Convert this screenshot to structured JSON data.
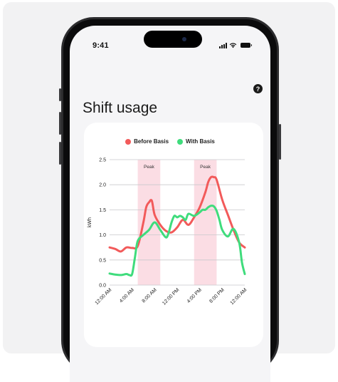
{
  "status_bar": {
    "time": "9:41"
  },
  "header": {
    "help_label": "?",
    "title": "Shift usage"
  },
  "colors": {
    "before": "#f25a5a",
    "with": "#3fdc7c",
    "peak_band": "#fbdde4"
  },
  "chart_data": {
    "type": "line",
    "ylabel": "kWh",
    "ylim": [
      0,
      2.5
    ],
    "yticks": [
      "0.0",
      "0.5",
      "1.0",
      "1.5",
      "2.0",
      "2.5"
    ],
    "xlim": [
      0,
      24
    ],
    "xticks": [
      {
        "hour": 0,
        "label": "12:00 AM"
      },
      {
        "hour": 4,
        "label": "4:00 AM"
      },
      {
        "hour": 8,
        "label": "8:00 AM"
      },
      {
        "hour": 12,
        "label": "12:00 PM"
      },
      {
        "hour": 16,
        "label": "4:00 PM"
      },
      {
        "hour": 20,
        "label": "8:00 PM"
      },
      {
        "hour": 24,
        "label": "12:00 AM"
      }
    ],
    "peaks": [
      {
        "label": "Peak",
        "start": 5,
        "end": 9
      },
      {
        "label": "Peak",
        "start": 15,
        "end": 19
      }
    ],
    "legend": [
      "Before Basis",
      "With Basis"
    ],
    "series": [
      {
        "name": "Before Basis",
        "points": [
          [
            0,
            0.75
          ],
          [
            1,
            0.72
          ],
          [
            2,
            0.67
          ],
          [
            3,
            0.75
          ],
          [
            4,
            0.74
          ],
          [
            5,
            0.78
          ],
          [
            6,
            1.25
          ],
          [
            6.5,
            1.55
          ],
          [
            7,
            1.65
          ],
          [
            7.5,
            1.68
          ],
          [
            8,
            1.4
          ],
          [
            9,
            1.2
          ],
          [
            10,
            1.08
          ],
          [
            11,
            1.05
          ],
          [
            12,
            1.15
          ],
          [
            13,
            1.3
          ],
          [
            14,
            1.2
          ],
          [
            15,
            1.35
          ],
          [
            16,
            1.55
          ],
          [
            17,
            1.85
          ],
          [
            17.5,
            2.05
          ],
          [
            18,
            2.15
          ],
          [
            18.5,
            2.15
          ],
          [
            19,
            2.1
          ],
          [
            20,
            1.7
          ],
          [
            21,
            1.4
          ],
          [
            22,
            1.1
          ],
          [
            23,
            0.85
          ],
          [
            24,
            0.75
          ]
        ]
      },
      {
        "name": "With Basis",
        "points": [
          [
            0,
            0.23
          ],
          [
            1,
            0.21
          ],
          [
            2,
            0.2
          ],
          [
            3,
            0.22
          ],
          [
            3.5,
            0.2
          ],
          [
            4,
            0.22
          ],
          [
            4.5,
            0.55
          ],
          [
            5,
            0.88
          ],
          [
            6,
            1.0
          ],
          [
            7,
            1.1
          ],
          [
            8,
            1.25
          ],
          [
            9,
            1.1
          ],
          [
            10,
            0.95
          ],
          [
            10.5,
            1.05
          ],
          [
            11,
            1.25
          ],
          [
            11.5,
            1.38
          ],
          [
            12,
            1.35
          ],
          [
            12.5,
            1.38
          ],
          [
            13,
            1.35
          ],
          [
            13.5,
            1.3
          ],
          [
            14,
            1.42
          ],
          [
            15,
            1.38
          ],
          [
            16,
            1.45
          ],
          [
            16.5,
            1.5
          ],
          [
            17,
            1.5
          ],
          [
            17.5,
            1.55
          ],
          [
            18,
            1.58
          ],
          [
            18.5,
            1.57
          ],
          [
            19,
            1.48
          ],
          [
            19.5,
            1.3
          ],
          [
            20,
            1.1
          ],
          [
            21,
            0.97
          ],
          [
            22,
            1.12
          ],
          [
            23,
            0.85
          ],
          [
            23.5,
            0.45
          ],
          [
            24,
            0.22
          ]
        ]
      }
    ]
  }
}
